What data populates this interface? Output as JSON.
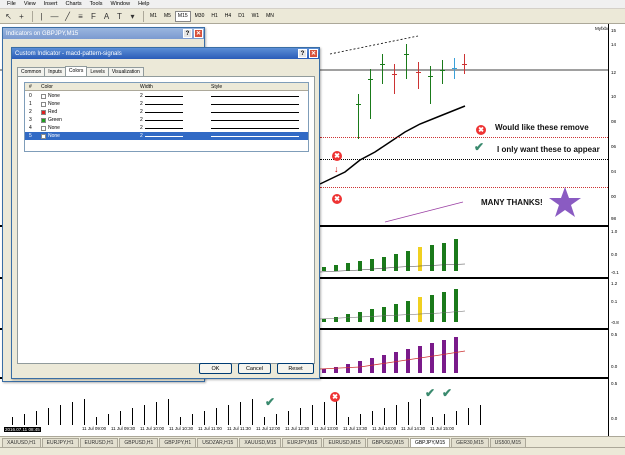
{
  "menubar": [
    "File",
    "View",
    "Insert",
    "Charts",
    "Tools",
    "Window",
    "Help"
  ],
  "toolbar": {
    "timeframes": [
      "M1",
      "M5",
      "M15",
      "M30",
      "H1",
      "H4",
      "D1",
      "W1",
      "MN"
    ],
    "active_timeframe": "M15"
  },
  "chart": {
    "brand_label": "Myfxbook",
    "price_labels": [
      "15",
      "14",
      "12",
      "10",
      "08",
      "06",
      "04",
      "00",
      "98"
    ],
    "pane_labels": [
      [
        "1.0",
        "0.0",
        "-0.1"
      ],
      [
        "1.2",
        "0.1",
        "-0.8"
      ],
      [
        "0.5",
        "0.0"
      ],
      [
        "0.5",
        "0.0"
      ]
    ],
    "time_labels": [
      "11 Jul 09:00",
      "11 Jul 09:30",
      "11 Jul 10:00",
      "11 Jul 10:30",
      "11 Jul 11:00",
      "11 Jul 11:30",
      "11 Jul 12:00",
      "11 Jul 12:30",
      "11 Jul 13:00",
      "11 Jul 13:30",
      "11 Jul 14:00",
      "11 Jul 14:30",
      "11 Jul 15:00"
    ],
    "time_highlight": "2016.07.11 08:45",
    "annotations": {
      "remove": "Would like these remove",
      "keep": "I only want these to appear",
      "thanks": "MANY THANKS!"
    },
    "colors": {
      "green": "#1a7a1a",
      "yellow": "#f0d020",
      "purple": "#7a1a8a",
      "red": "#cc2222"
    }
  },
  "symbol_tabs": [
    "XAUUSD,H1",
    "EURJPY,H1",
    "EURUSD,H1",
    "GBPUSD,H1",
    "GBPJPY,H1",
    "USDZAR,H15",
    "XAUUSD,M15",
    "EURJPY,M15",
    "EURUSD,M15",
    "GBPUSD,M15",
    "GBPJPY,M15",
    "GER30,M15",
    "US500,M15"
  ],
  "active_symbol_tab": "GBPJPY,M15",
  "indicators_window": {
    "title": "Indicators on GBPJPY,M15"
  },
  "dialog": {
    "title": "Custom Indicator - macd-pattern-signals",
    "tabs": [
      "Common",
      "Inputs",
      "Colors",
      "Levels",
      "Visualization"
    ],
    "active_tab": "Colors",
    "columns": [
      "#",
      "Color",
      "Width",
      "Style"
    ],
    "rows": [
      {
        "index": "0",
        "color_name": "None",
        "swatch": "#ffffff",
        "width": "2"
      },
      {
        "index": "1",
        "color_name": "None",
        "swatch": "#ffffff",
        "width": "2"
      },
      {
        "index": "2",
        "color_name": "Red",
        "swatch": "#e02020",
        "width": "2"
      },
      {
        "index": "3",
        "color_name": "Green",
        "swatch": "#20a020",
        "width": "2"
      },
      {
        "index": "4",
        "color_name": "None",
        "swatch": "#ffffff",
        "width": "2"
      },
      {
        "index": "5",
        "color_name": "None",
        "swatch": "#ffffff",
        "width": "2"
      }
    ],
    "selected_row": "5",
    "buttons": {
      "ok": "OK",
      "cancel": "Cancel",
      "reset": "Reset"
    }
  }
}
